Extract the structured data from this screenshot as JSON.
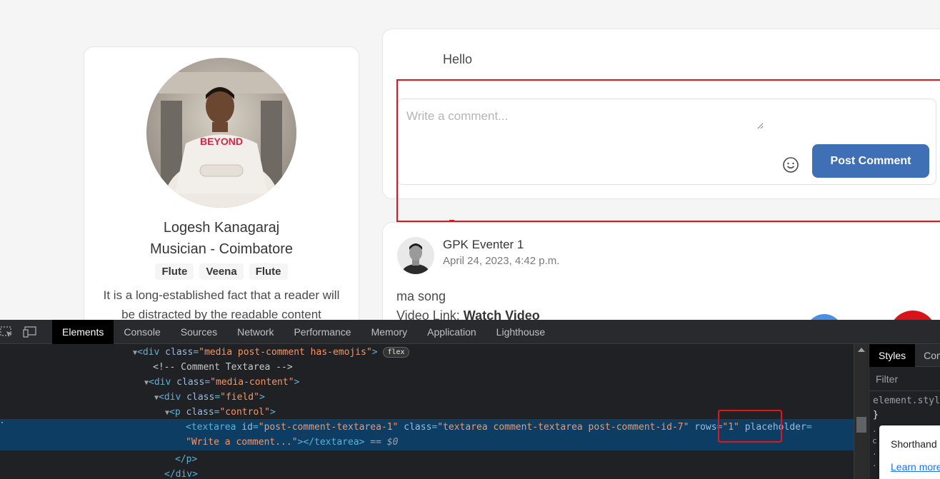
{
  "profile": {
    "name": "Logesh Kanagaraj",
    "role": "Musician - Coimbatore",
    "tags": [
      "Flute",
      "Veena",
      "Flute"
    ],
    "bio": "It is a long-established fact that a reader will be distracted by the readable content"
  },
  "previous_comment": {
    "text": "Hello"
  },
  "comment_form": {
    "placeholder": "Write a comment...",
    "post_button": "Post Comment",
    "emoji_icon": "smiley-icon"
  },
  "post": {
    "author": "GPK Eventer 1",
    "date": "April 24, 2023, 4:42 p.m.",
    "text": "ma song",
    "video_label": "Video Link:",
    "video_link": "Watch Video"
  },
  "devtools": {
    "tabs": [
      "Elements",
      "Console",
      "Sources",
      "Network",
      "Performance",
      "Memory",
      "Application",
      "Lighthouse"
    ],
    "active_tab": "Elements",
    "dom": {
      "line1_tag": "div",
      "line1_class_attr": "class",
      "line1_class_val": "\"media post-comment has-emojis\"",
      "line1_badge": "flex",
      "line2_comment": "<!-- Comment Textarea -->",
      "line3_tag": "div",
      "line3_attr": "class",
      "line3_val": "\"media-content\"",
      "line4_tag": "div",
      "line4_attr": "class",
      "line4_val": "\"field\"",
      "line5_tag": "p",
      "line5_attr": "class",
      "line5_val": "\"control\"",
      "sel_tag": "textarea",
      "sel_id_attr": "id",
      "sel_id_val": "\"post-comment-textarea-1\"",
      "sel_class_attr": "class",
      "sel_class_val": "\"textarea comment-textarea post-comment-id-7\"",
      "sel_rows_attr": "rows",
      "sel_rows_val": "\"1\"",
      "sel_placeholder_attr": "placeholder",
      "sel_placeholder_val": "\"Write a comment...\"",
      "sel_close": "</textarea>",
      "sel_ref": "== $0",
      "close_p": "</p>",
      "close_div": "</div>"
    },
    "styles": {
      "tabs": [
        "Styles",
        "Com"
      ],
      "active_tab": "Styles",
      "filter_placeholder": "Filter",
      "rule_selector": "element.style",
      "rule_close": "}",
      "tooltip_title": "Shorthand",
      "tooltip_link": "Learn more"
    }
  },
  "colors": {
    "post_button": "#3f6fb4",
    "highlight": "#e3141b",
    "devtools_bg": "#202124",
    "selected_row": "#0e3d64"
  }
}
